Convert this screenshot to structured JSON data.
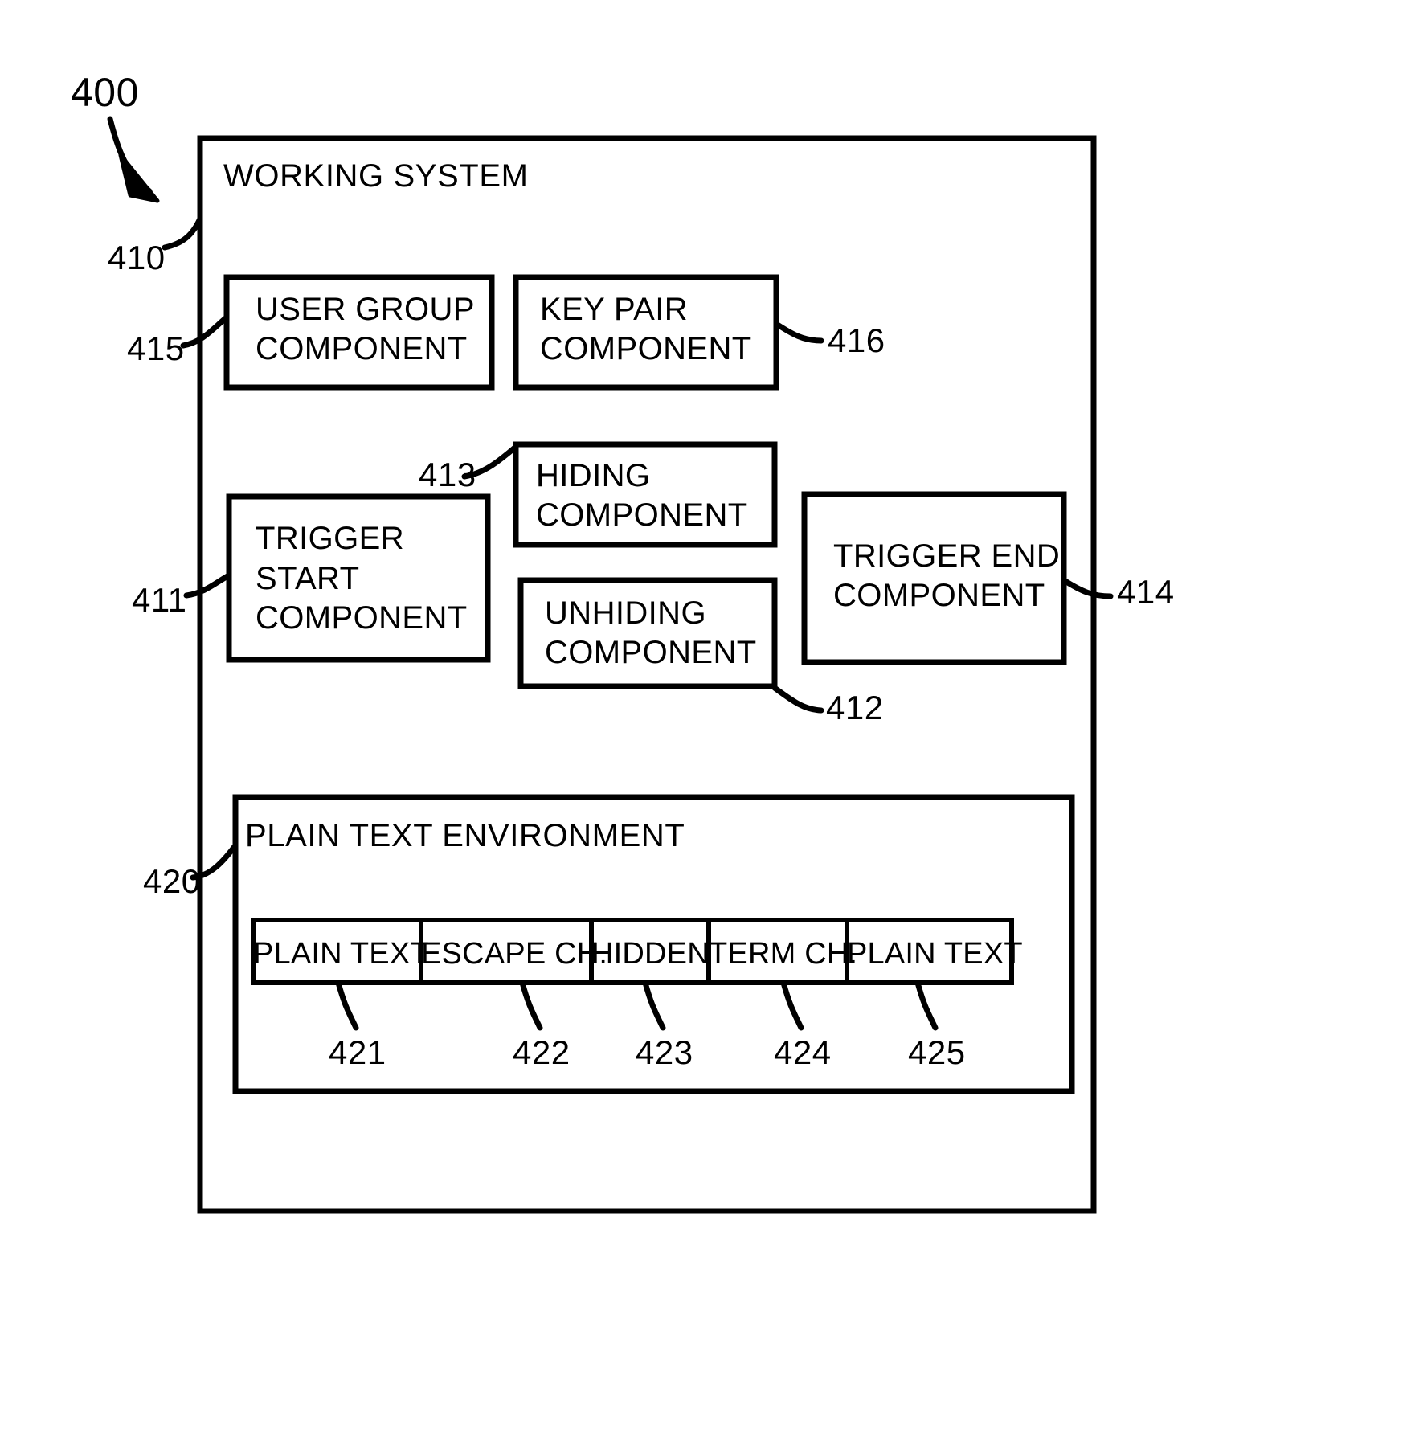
{
  "figure": {
    "number": "400",
    "outer_container_label": "WORKING SYSTEM",
    "outer_container_ref": "410",
    "inner_container_label": "PLAIN TEXT ENVIRONMENT",
    "inner_container_ref": "420"
  },
  "components": [
    {
      "ref": "415",
      "label_line1": "USER GROUP",
      "label_line2": "COMPONENT",
      "label_line3": ""
    },
    {
      "ref": "416",
      "label_line1": "KEY PAIR",
      "label_line2": "COMPONENT",
      "label_line3": ""
    },
    {
      "ref": "413",
      "label_line1": "HIDING",
      "label_line2": "COMPONENT",
      "label_line3": ""
    },
    {
      "ref": "411",
      "label_line1": "TRIGGER",
      "label_line2": "START",
      "label_line3": "COMPONENT"
    },
    {
      "ref": "412",
      "label_line1": "UNHIDING",
      "label_line2": "COMPONENT",
      "label_line3": ""
    },
    {
      "ref": "414",
      "label_line1": "TRIGGER END",
      "label_line2": "COMPONENT",
      "label_line3": ""
    }
  ],
  "segments": [
    {
      "ref": "421",
      "label": "PLAIN TEXT"
    },
    {
      "ref": "422",
      "label": "ESCAPE CH."
    },
    {
      "ref": "423",
      "label": "HIDDEN"
    },
    {
      "ref": "424",
      "label": "TERM CH."
    },
    {
      "ref": "425",
      "label": "PLAIN TEXT"
    }
  ],
  "colors": {
    "line": "#000000",
    "background": "#ffffff"
  }
}
